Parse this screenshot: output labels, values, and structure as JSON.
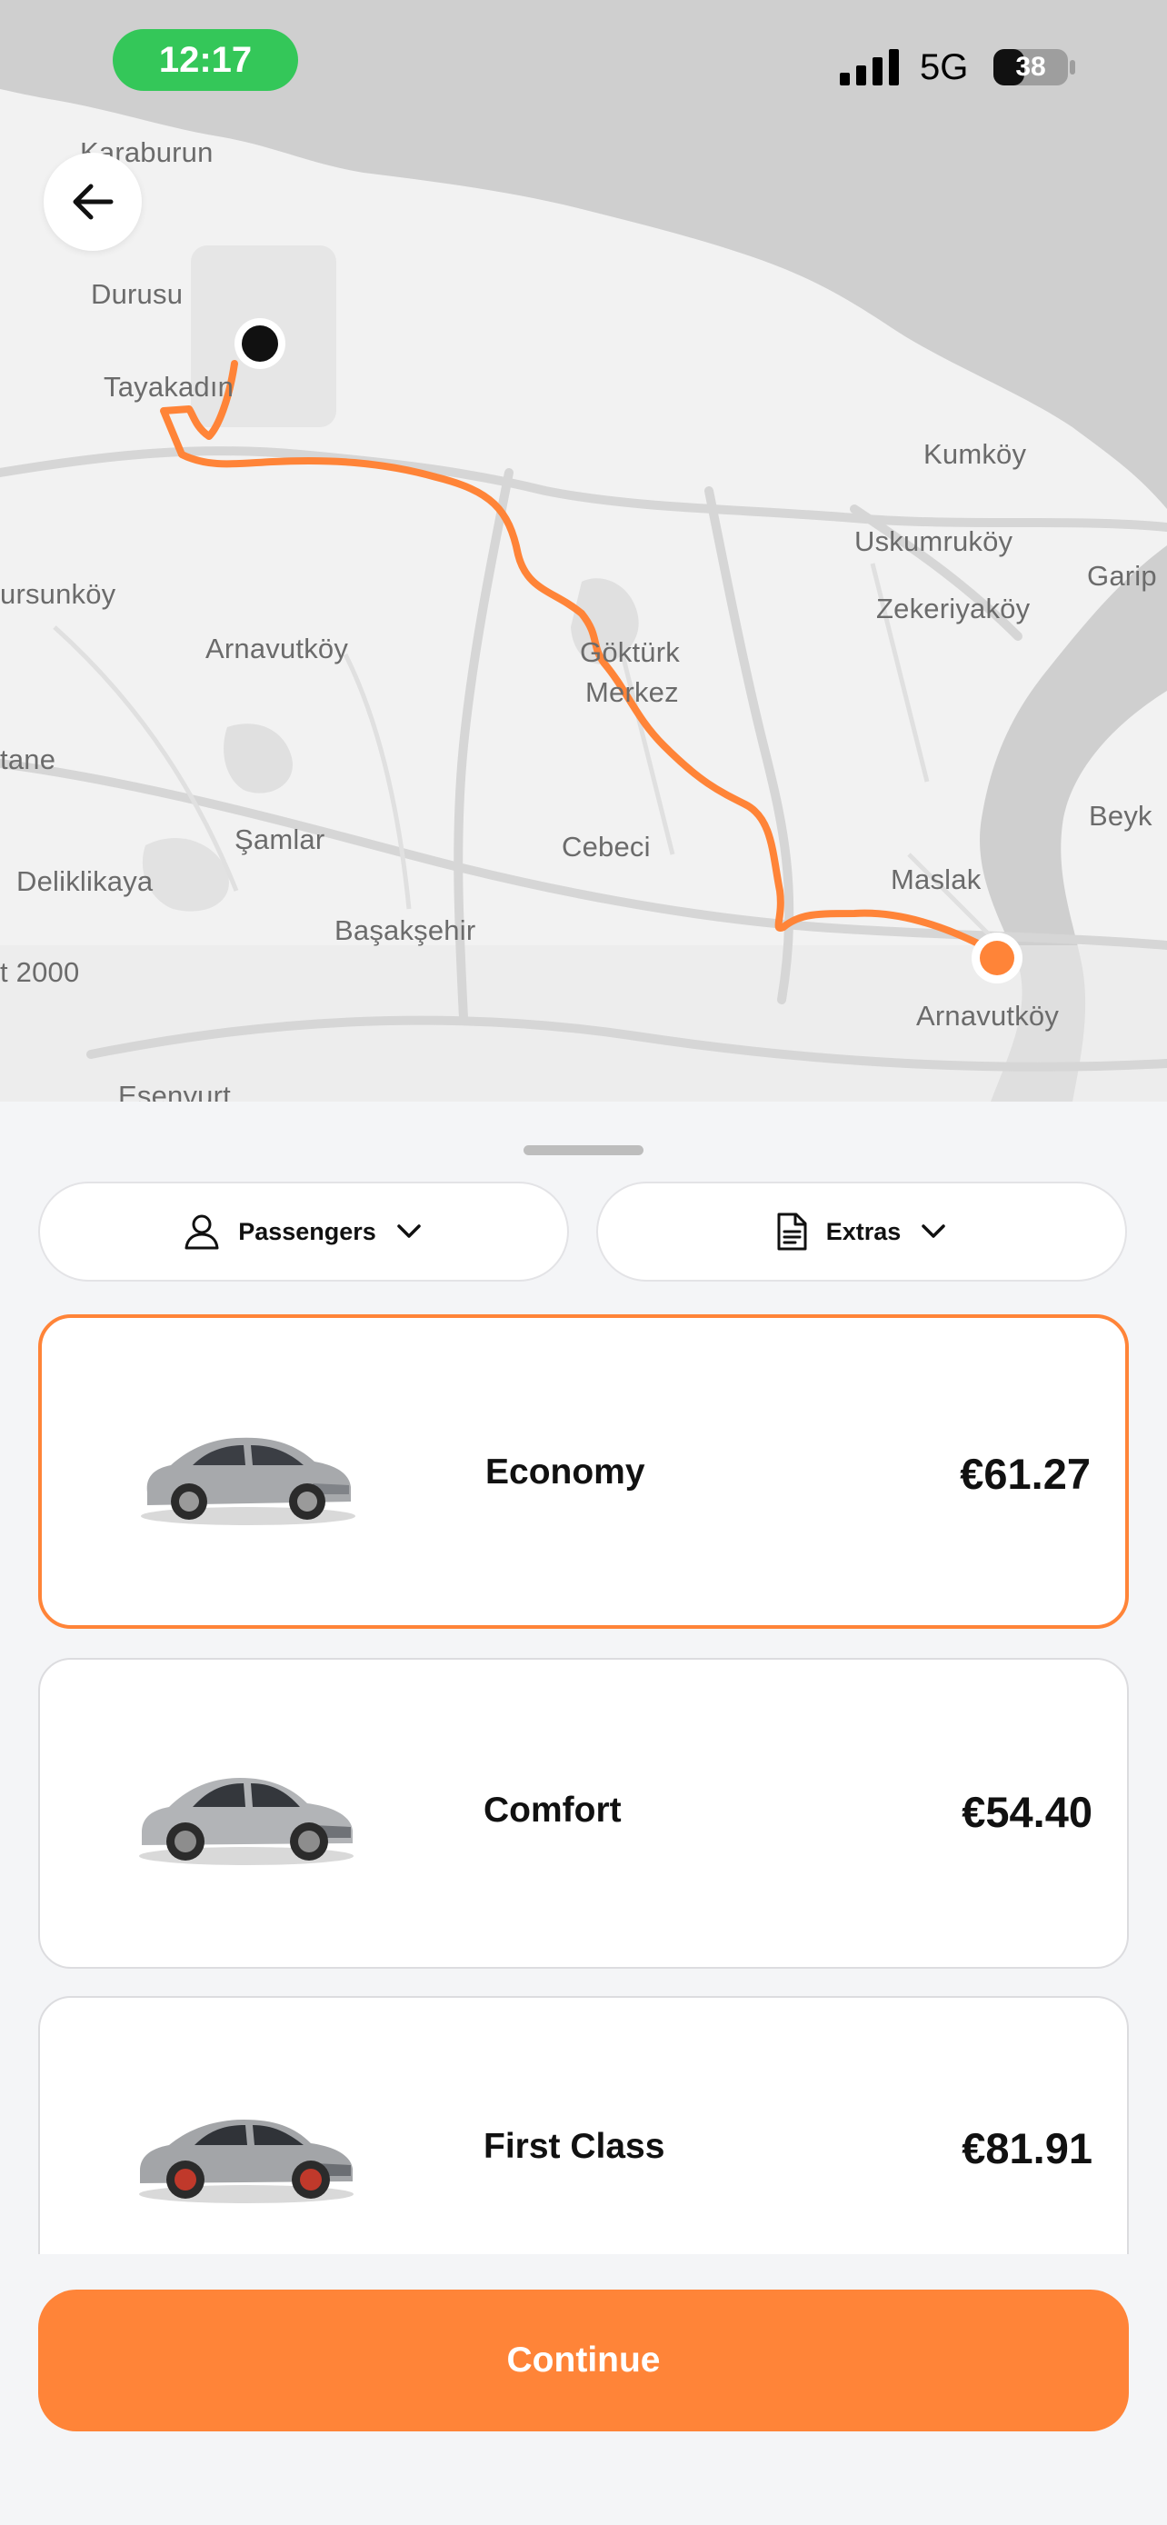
{
  "status_bar": {
    "time": "12:17",
    "network": "5G",
    "battery": "38"
  },
  "map": {
    "places": [
      {
        "name": "Karaburun"
      },
      {
        "name": "Durusu"
      },
      {
        "name": "Tayakadın"
      },
      {
        "name": "Kumköy"
      },
      {
        "name": "Uskumruköy"
      },
      {
        "name": "Garip"
      },
      {
        "name": "ursunköy"
      },
      {
        "name": "Zekeriyaköy"
      },
      {
        "name": "Arnavutköy"
      },
      {
        "name": "Göktürk"
      },
      {
        "name": "Merkez"
      },
      {
        "name": "tane"
      },
      {
        "name": "Beyk"
      },
      {
        "name": "Şamlar"
      },
      {
        "name": "Cebeci"
      },
      {
        "name": "Maslak"
      },
      {
        "name": "Deliklikaya"
      },
      {
        "name": "Başakşehir"
      },
      {
        "name": "t 2000"
      },
      {
        "name": "Arnavutköy"
      },
      {
        "name": "Esenyurt"
      }
    ],
    "route_color": "#ff8438",
    "origin_marker_color": "#111111",
    "destination_marker_color": "#ff8438"
  },
  "filters": {
    "passengers_label": "Passengers",
    "extras_label": "Extras"
  },
  "vehicle_classes": [
    {
      "name": "Economy",
      "price": "€61.27",
      "selected": true
    },
    {
      "name": "Comfort",
      "price": "€54.40",
      "selected": false
    },
    {
      "name": "First Class",
      "price": "€81.91",
      "selected": false
    }
  ],
  "continue_label": "Continue",
  "colors": {
    "accent": "#ff8438",
    "time_pill": "#34c759",
    "sheet_background": "#f4f5f7"
  }
}
